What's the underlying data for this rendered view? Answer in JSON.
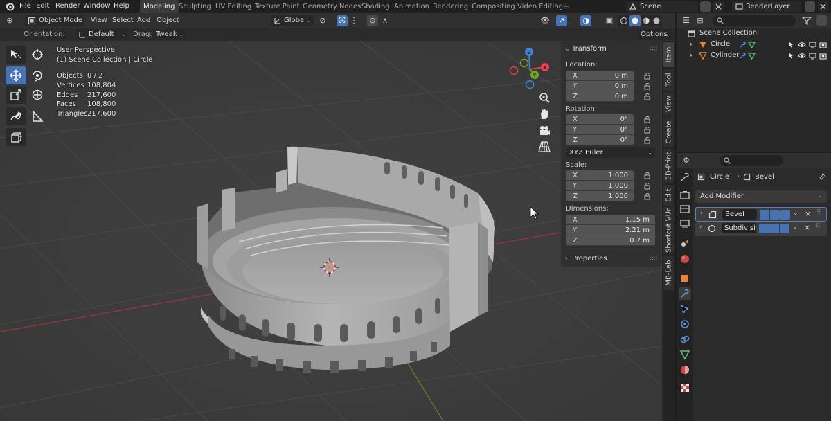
{
  "topbar": {
    "menus": [
      "File",
      "Edit",
      "Render",
      "Window",
      "Help"
    ],
    "workspaces": [
      "Modeling",
      "Sculpting",
      "UV Editing",
      "Texture Paint",
      "Geometry Nodes",
      "Shading",
      "Animation",
      "Rendering",
      "Compositing",
      "Video Editing"
    ],
    "active_workspace": "Modeling",
    "add_workspace": "+",
    "scene": "Scene",
    "view_layer": "RenderLayer"
  },
  "viewport_header": {
    "mode": "Object Mode",
    "menus": [
      "View",
      "Select",
      "Add",
      "Object"
    ],
    "transform_orientation": "Global",
    "orientation_label": "Orientation:",
    "orientation_value": "Default",
    "drag_label": "Drag:",
    "drag_value": "Tweak",
    "options": "Options"
  },
  "overlay": {
    "view_name": "User Perspective",
    "collection": "(1) Scene Collection | Circle",
    "stats": [
      {
        "label": "Objects",
        "value": "0 / 2"
      },
      {
        "label": "Vertices",
        "value": "108,804"
      },
      {
        "label": "Edges",
        "value": "217,600"
      },
      {
        "label": "Faces",
        "value": "108,800"
      },
      {
        "label": "Triangles",
        "value": "217,600"
      }
    ]
  },
  "gizmo": {
    "x": "X",
    "y": "Y",
    "z": "Z"
  },
  "npanel": {
    "transform_title": "Transform",
    "location_label": "Location:",
    "location": [
      {
        "axis": "X",
        "value": "0 m"
      },
      {
        "axis": "Y",
        "value": "0 m"
      },
      {
        "axis": "Z",
        "value": "0 m"
      }
    ],
    "rotation_label": "Rotation:",
    "rotation": [
      {
        "axis": "X",
        "value": "0°"
      },
      {
        "axis": "Y",
        "value": "0°"
      },
      {
        "axis": "Z",
        "value": "0°"
      }
    ],
    "rotation_mode": "XYZ Euler",
    "scale_label": "Scale:",
    "scale": [
      {
        "axis": "X",
        "value": "1.000"
      },
      {
        "axis": "Y",
        "value": "1.000"
      },
      {
        "axis": "Z",
        "value": "1.000"
      }
    ],
    "dimensions_label": "Dimensions:",
    "dimensions": [
      {
        "axis": "X",
        "value": "1.15 m"
      },
      {
        "axis": "Y",
        "value": "2.21 m"
      },
      {
        "axis": "Z",
        "value": "0.7 m"
      }
    ],
    "properties_title": "Properties",
    "tabs": [
      "Item",
      "Tool",
      "View",
      "Create",
      "3D-Print",
      "Edit",
      "Shortcut VUr",
      "MB-Lab"
    ]
  },
  "outliner": {
    "root": "Scene Collection",
    "items": [
      {
        "name": "Circle"
      },
      {
        "name": "Cylinder"
      }
    ]
  },
  "properties": {
    "breadcrumb_object": "Circle",
    "breadcrumb_modifier": "Bevel",
    "add_modifier": "Add Modifier",
    "modifiers": [
      {
        "name": "Bevel"
      },
      {
        "name": "Subdivisi..."
      }
    ]
  },
  "colors": {
    "accent": "#4772b3",
    "viewport_bg": "#3d3d3d",
    "axis_x": "#e0404f",
    "axis_y": "#6ea627",
    "axis_z": "#3b86d8",
    "object_orange": "#e8833a"
  }
}
